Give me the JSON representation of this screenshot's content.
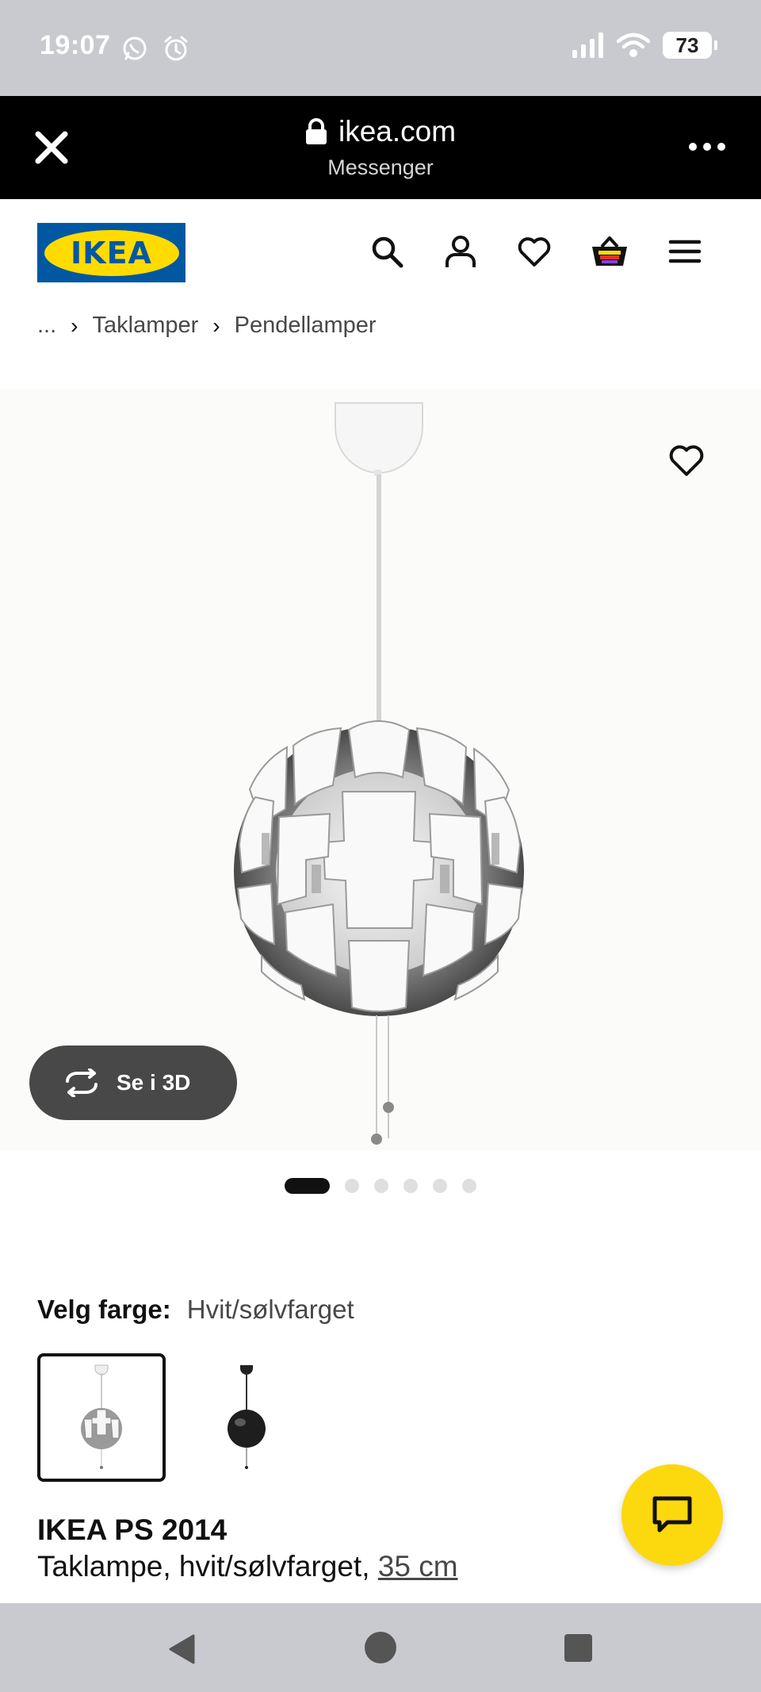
{
  "status_bar": {
    "time": "19:07",
    "battery": "73",
    "icons": [
      "whatsapp-icon",
      "alarm-icon",
      "signal-icon",
      "wifi-icon",
      "battery-icon"
    ]
  },
  "browser": {
    "domain": "ikea.com",
    "subtitle": "Messenger",
    "icons": [
      "close-icon",
      "lock-icon",
      "more-icon"
    ]
  },
  "header": {
    "logo_text": "IKEA",
    "icons": [
      "search-icon",
      "user-icon",
      "heart-icon",
      "basket-icon",
      "menu-icon"
    ]
  },
  "breadcrumb": {
    "ellipsis": "...",
    "items": [
      "Taklamper",
      "Pendellamper"
    ]
  },
  "gallery": {
    "see_3d_label": "Se i 3D",
    "image_count": 6,
    "active_index": 0
  },
  "color": {
    "label": "Velg farge:",
    "value": "Hvit/sølvfarget",
    "options": [
      "Hvit/sølvfarget",
      "Svart"
    ]
  },
  "product": {
    "name": "IKEA PS 2014",
    "description_prefix": "Taklampe, hvit/sølvfarget, ",
    "size_link": "35 cm"
  },
  "colors": {
    "ikea_blue": "#0058a3",
    "ikea_yellow": "#ffdb00",
    "chat_yellow": "#fcd80e",
    "see3d_bg": "#484848"
  }
}
